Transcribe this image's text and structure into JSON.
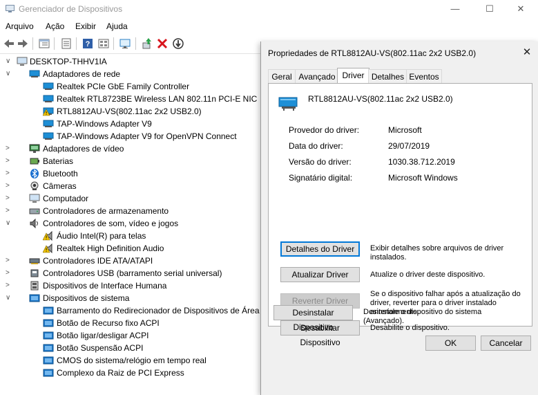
{
  "app": {
    "title": "Gerenciador de Dispositivos",
    "window_controls": {
      "minimize": "—",
      "maximize": "☐",
      "close": "✕"
    }
  },
  "menu": [
    "Arquivo",
    "Ação",
    "Exibir",
    "Ajuda"
  ],
  "toolbar_icons": [
    "back-arrow-icon",
    "forward-arrow-icon",
    "view-icon",
    "properties-icon",
    "help-icon",
    "show-hidden-icon",
    "scan-monitor-icon",
    "update-driver-icon",
    "uninstall-icon",
    "disable-icon"
  ],
  "tree": {
    "root": "DESKTOP-THHV1IA",
    "items": [
      {
        "label": "Adaptadores de rede",
        "level": 1,
        "expander": "∨",
        "icon": "network-adapter-icon"
      },
      {
        "label": "Realtek PCIe GbE Family Controller",
        "level": 2,
        "expander": "",
        "icon": "network-adapter-icon"
      },
      {
        "label": "Realtek RTL8723BE Wireless LAN 802.11n PCI-E NIC",
        "level": 2,
        "expander": "",
        "icon": "network-adapter-icon"
      },
      {
        "label": "RTL8812AU-VS(802.11ac 2x2 USB2.0)",
        "level": 2,
        "expander": "",
        "icon": "warning-network-adapter-icon"
      },
      {
        "label": "TAP-Windows Adapter V9",
        "level": 2,
        "expander": "",
        "icon": "network-adapter-icon"
      },
      {
        "label": "TAP-Windows Adapter V9 for OpenVPN Connect",
        "level": 2,
        "expander": "",
        "icon": "network-adapter-icon"
      },
      {
        "label": "Adaptadores de vídeo",
        "level": 1,
        "expander": ">",
        "icon": "display-adapter-icon"
      },
      {
        "label": "Baterias",
        "level": 1,
        "expander": ">",
        "icon": "battery-icon"
      },
      {
        "label": "Bluetooth",
        "level": 1,
        "expander": ">",
        "icon": "bluetooth-icon"
      },
      {
        "label": "Câmeras",
        "level": 1,
        "expander": ">",
        "icon": "camera-icon"
      },
      {
        "label": "Computador",
        "level": 1,
        "expander": ">",
        "icon": "computer-icon"
      },
      {
        "label": "Controladores de armazenamento",
        "level": 1,
        "expander": ">",
        "icon": "storage-controller-icon"
      },
      {
        "label": "Controladores de som, vídeo e jogos",
        "level": 1,
        "expander": "∨",
        "icon": "sound-icon"
      },
      {
        "label": "Áudio Intel(R) para telas",
        "level": 2,
        "expander": "",
        "icon": "warning-speaker-icon"
      },
      {
        "label": "Realtek High Definition Audio",
        "level": 2,
        "expander": "",
        "icon": "warning-speaker-icon"
      },
      {
        "label": "Controladores IDE ATA/ATAPI",
        "level": 1,
        "expander": ">",
        "icon": "ide-controller-icon"
      },
      {
        "label": "Controladores USB (barramento serial universal)",
        "level": 1,
        "expander": ">",
        "icon": "usb-icon"
      },
      {
        "label": "Dispositivos de Interface Humana",
        "level": 1,
        "expander": ">",
        "icon": "hid-icon"
      },
      {
        "label": "Dispositivos de sistema",
        "level": 1,
        "expander": "∨",
        "icon": "system-devices-icon"
      },
      {
        "label": "Barramento do Redirecionador de Dispositivos de Área de",
        "level": 2,
        "expander": "",
        "icon": "system-device-icon"
      },
      {
        "label": "Botão de Recurso fixo ACPI",
        "level": 2,
        "expander": "",
        "icon": "system-device-icon"
      },
      {
        "label": "Botão ligar/desligar ACPI",
        "level": 2,
        "expander": "",
        "icon": "system-device-icon"
      },
      {
        "label": "Botão Suspensão ACPI",
        "level": 2,
        "expander": "",
        "icon": "system-device-icon"
      },
      {
        "label": "CMOS do sistema/relógio em tempo real",
        "level": 2,
        "expander": "",
        "icon": "system-device-icon"
      },
      {
        "label": "Complexo da Raiz de PCI Express",
        "level": 2,
        "expander": "",
        "icon": "system-device-icon"
      }
    ]
  },
  "dialog": {
    "title": "Propriedades de RTL8812AU-VS(802.11ac 2x2 USB2.0)",
    "close": "✕",
    "tabs": [
      "Geral",
      "Avançado",
      "Driver",
      "Detalhes",
      "Eventos"
    ],
    "active_tab": "Driver",
    "device_name": "RTL8812AU-VS(802.11ac 2x2 USB2.0)",
    "properties": [
      {
        "label": "Provedor do driver:",
        "value": "Microsoft"
      },
      {
        "label": "Data do driver:",
        "value": "29/07/2019"
      },
      {
        "label": "Versão do driver:",
        "value": "1030.38.712.2019"
      },
      {
        "label": "Signatário digital:",
        "value": "Microsoft Windows"
      }
    ],
    "actions": [
      {
        "button": "Detalhes do Driver",
        "description": "Exibir detalhes sobre arquivos de driver instalados.",
        "state": "focused"
      },
      {
        "button": "Atualizar Driver",
        "description": "Atualize o driver deste dispositivo.",
        "state": "normal"
      },
      {
        "button": "Reverter Driver",
        "description": "Se o dispositivo falhar após a atualização do driver, reverter para o driver instalado anteriormente.",
        "state": "disabled"
      },
      {
        "button": "Desabilitar Dispositivo",
        "description": "Desabilite o dispositivo.",
        "state": "normal"
      },
      {
        "button": "Desinstalar Dispositivo",
        "description": "Desinstale o dispositivo do sistema (Avançado).",
        "state": "normal"
      }
    ],
    "ok_label": "OK",
    "cancel_label": "Cancelar"
  },
  "colors": {
    "accent": "#0078d7",
    "warning": "#f2c500",
    "network_icon": "#1e8fd6"
  }
}
